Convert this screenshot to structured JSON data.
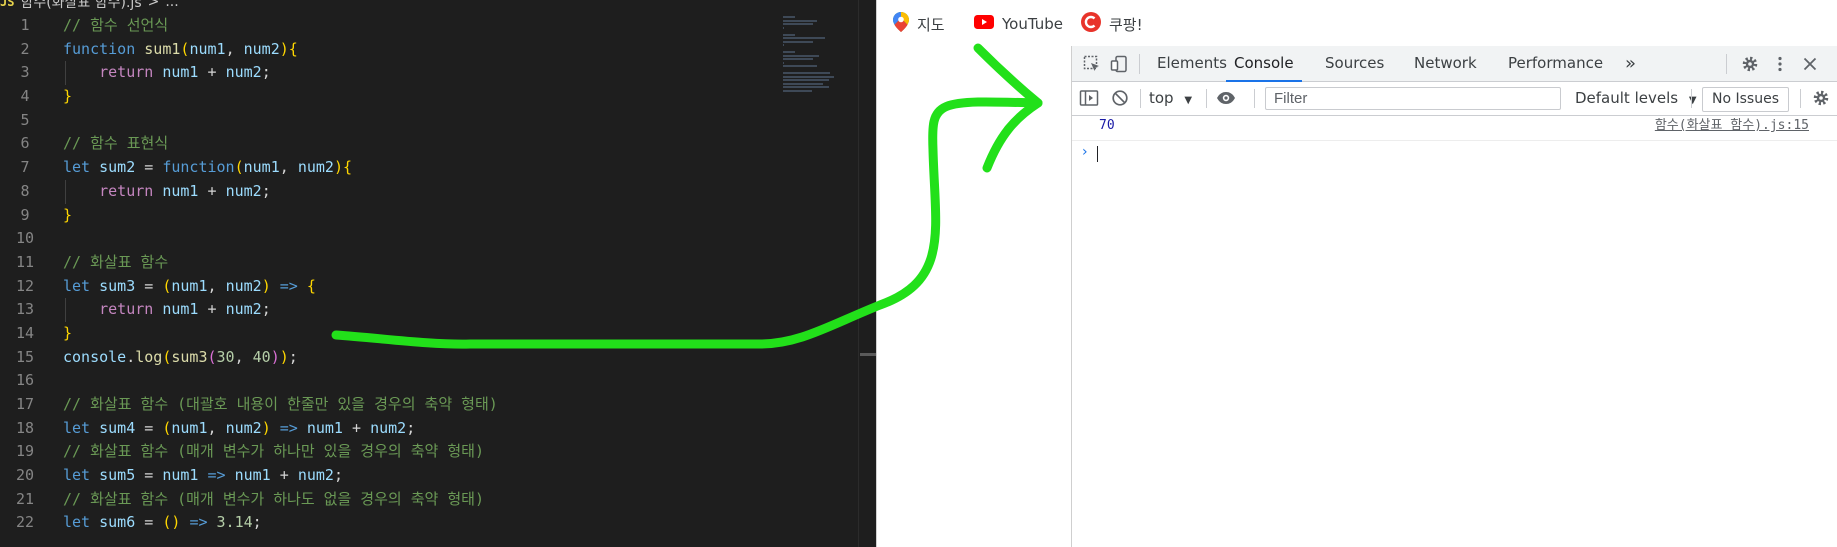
{
  "editor": {
    "breadcrumb": {
      "badge": "JS",
      "filename": "함수(화살표 함수).js",
      "sep": ">",
      "more": "..."
    },
    "lines": [
      {
        "n": "1",
        "indent": false,
        "tokens": [
          {
            "t": "// 함수 선언식",
            "c": "cm"
          }
        ]
      },
      {
        "n": "2",
        "indent": false,
        "tokens": [
          {
            "t": "function",
            "c": "kw"
          },
          {
            "t": " "
          },
          {
            "t": "sum1",
            "c": "fn"
          },
          {
            "t": "(",
            "c": "b1"
          },
          {
            "t": "num1",
            "c": "var"
          },
          {
            "t": ", "
          },
          {
            "t": "num2",
            "c": "var"
          },
          {
            "t": ")",
            "c": "b1"
          },
          {
            "t": "{",
            "c": "b1"
          }
        ]
      },
      {
        "n": "3",
        "indent": true,
        "tokens": [
          {
            "t": "    "
          },
          {
            "t": "return",
            "c": "kw2"
          },
          {
            "t": " "
          },
          {
            "t": "num1",
            "c": "var"
          },
          {
            "t": " + "
          },
          {
            "t": "num2",
            "c": "var"
          },
          {
            "t": ";"
          }
        ]
      },
      {
        "n": "4",
        "indent": false,
        "tokens": [
          {
            "t": "}",
            "c": "b1"
          }
        ]
      },
      {
        "n": "5",
        "indent": false,
        "tokens": []
      },
      {
        "n": "6",
        "indent": false,
        "tokens": [
          {
            "t": "// 함수 표현식",
            "c": "cm"
          }
        ]
      },
      {
        "n": "7",
        "indent": false,
        "tokens": [
          {
            "t": "let",
            "c": "kw"
          },
          {
            "t": " "
          },
          {
            "t": "sum2",
            "c": "var"
          },
          {
            "t": " = "
          },
          {
            "t": "function",
            "c": "kw"
          },
          {
            "t": "(",
            "c": "b1"
          },
          {
            "t": "num1",
            "c": "var"
          },
          {
            "t": ", "
          },
          {
            "t": "num2",
            "c": "var"
          },
          {
            "t": ")",
            "c": "b1"
          },
          {
            "t": "{",
            "c": "b1"
          }
        ]
      },
      {
        "n": "8",
        "indent": true,
        "tokens": [
          {
            "t": "    "
          },
          {
            "t": "return",
            "c": "kw2"
          },
          {
            "t": " "
          },
          {
            "t": "num1",
            "c": "var"
          },
          {
            "t": " + "
          },
          {
            "t": "num2",
            "c": "var"
          },
          {
            "t": ";"
          }
        ]
      },
      {
        "n": "9",
        "indent": false,
        "tokens": [
          {
            "t": "}",
            "c": "b1"
          }
        ]
      },
      {
        "n": "10",
        "indent": false,
        "tokens": []
      },
      {
        "n": "11",
        "indent": false,
        "tokens": [
          {
            "t": "// 화살표 함수",
            "c": "cm"
          }
        ]
      },
      {
        "n": "12",
        "indent": false,
        "tokens": [
          {
            "t": "let",
            "c": "kw"
          },
          {
            "t": " "
          },
          {
            "t": "sum3",
            "c": "var"
          },
          {
            "t": " = "
          },
          {
            "t": "(",
            "c": "b1"
          },
          {
            "t": "num1",
            "c": "var"
          },
          {
            "t": ", "
          },
          {
            "t": "num2",
            "c": "var"
          },
          {
            "t": ")",
            "c": "b1"
          },
          {
            "t": " "
          },
          {
            "t": "=>",
            "c": "kw"
          },
          {
            "t": " "
          },
          {
            "t": "{",
            "c": "b1"
          }
        ]
      },
      {
        "n": "13",
        "indent": true,
        "tokens": [
          {
            "t": "    "
          },
          {
            "t": "return",
            "c": "kw2"
          },
          {
            "t": " "
          },
          {
            "t": "num1",
            "c": "var"
          },
          {
            "t": " + "
          },
          {
            "t": "num2",
            "c": "var"
          },
          {
            "t": ";"
          }
        ]
      },
      {
        "n": "14",
        "indent": false,
        "tokens": [
          {
            "t": "}",
            "c": "b1"
          }
        ]
      },
      {
        "n": "15",
        "indent": false,
        "tokens": [
          {
            "t": "console",
            "c": "var"
          },
          {
            "t": "."
          },
          {
            "t": "log",
            "c": "fn"
          },
          {
            "t": "(",
            "c": "b1"
          },
          {
            "t": "sum3",
            "c": "fn"
          },
          {
            "t": "(",
            "c": "b2"
          },
          {
            "t": "30",
            "c": "num"
          },
          {
            "t": ", "
          },
          {
            "t": "40",
            "c": "num"
          },
          {
            "t": ")",
            "c": "b2"
          },
          {
            "t": ")",
            "c": "b1"
          },
          {
            "t": ";"
          }
        ]
      },
      {
        "n": "16",
        "indent": false,
        "tokens": []
      },
      {
        "n": "17",
        "indent": false,
        "tokens": [
          {
            "t": "// 화살표 함수 (대괄호 내용이 한줄만 있을 경우의 축약 형태)",
            "c": "cm"
          }
        ]
      },
      {
        "n": "18",
        "indent": false,
        "tokens": [
          {
            "t": "let",
            "c": "kw"
          },
          {
            "t": " "
          },
          {
            "t": "sum4",
            "c": "var"
          },
          {
            "t": " = "
          },
          {
            "t": "(",
            "c": "b1"
          },
          {
            "t": "num1",
            "c": "var"
          },
          {
            "t": ", "
          },
          {
            "t": "num2",
            "c": "var"
          },
          {
            "t": ")",
            "c": "b1"
          },
          {
            "t": " "
          },
          {
            "t": "=>",
            "c": "kw"
          },
          {
            "t": " "
          },
          {
            "t": "num1",
            "c": "var"
          },
          {
            "t": " + "
          },
          {
            "t": "num2",
            "c": "var"
          },
          {
            "t": ";"
          }
        ]
      },
      {
        "n": "19",
        "indent": false,
        "tokens": [
          {
            "t": "// 화살표 함수 (매개 변수가 하나만 있을 경우의 축약 형태)",
            "c": "cm"
          }
        ]
      },
      {
        "n": "20",
        "indent": false,
        "tokens": [
          {
            "t": "let",
            "c": "kw"
          },
          {
            "t": " "
          },
          {
            "t": "sum5",
            "c": "var"
          },
          {
            "t": " = "
          },
          {
            "t": "num1",
            "c": "var"
          },
          {
            "t": " "
          },
          {
            "t": "=>",
            "c": "kw"
          },
          {
            "t": " "
          },
          {
            "t": "num1",
            "c": "var"
          },
          {
            "t": " + "
          },
          {
            "t": "num2",
            "c": "var"
          },
          {
            "t": ";"
          }
        ]
      },
      {
        "n": "21",
        "indent": false,
        "tokens": [
          {
            "t": "// 화살표 함수 (매개 변수가 하나도 없을 경우의 축약 형태)",
            "c": "cm"
          }
        ]
      },
      {
        "n": "22",
        "indent": false,
        "tokens": [
          {
            "t": "let",
            "c": "kw"
          },
          {
            "t": " "
          },
          {
            "t": "sum6",
            "c": "var"
          },
          {
            "t": " = "
          },
          {
            "t": "(",
            "c": "b1"
          },
          {
            "t": ")",
            "c": "b1"
          },
          {
            "t": " "
          },
          {
            "t": "=>",
            "c": "kw"
          },
          {
            "t": " "
          },
          {
            "t": "3.14",
            "c": "num"
          },
          {
            "t": ";"
          }
        ]
      }
    ]
  },
  "browser": {
    "bookmarks": [
      {
        "label": "지도",
        "icon": "maps-pin-icon"
      },
      {
        "label": "YouTube",
        "icon": "youtube-icon"
      },
      {
        "label": "쿠팡!",
        "icon": "coupang-icon"
      }
    ]
  },
  "devtools": {
    "tabs": [
      {
        "label": "Elements",
        "active": false
      },
      {
        "label": "Console",
        "active": true
      },
      {
        "label": "Sources",
        "active": false
      },
      {
        "label": "Network",
        "active": false
      },
      {
        "label": "Performance",
        "active": false
      }
    ],
    "more_tabs": "»",
    "toolbar": {
      "context": "top",
      "filter_placeholder": "Filter",
      "levels": "Default levels",
      "issues": "No Issues"
    },
    "console": {
      "output_value": "70",
      "output_source": "함수(화살표 함수).js:15",
      "prompt": "›"
    }
  },
  "colors": {
    "editor_bg": "#1e1e1e",
    "comment": "#6a9955",
    "keyword": "#569cd6",
    "active_tab_underline": "#1a73e8",
    "annotation_arrow": "#22e01a"
  }
}
